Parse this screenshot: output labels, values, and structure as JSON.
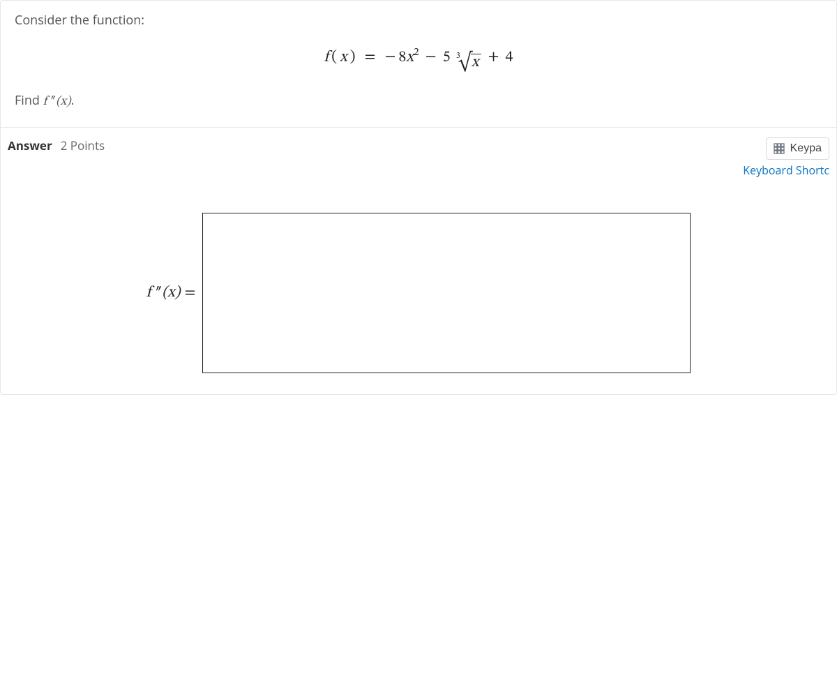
{
  "question": {
    "intro": "Consider the function:",
    "formula_plain": "f(x) = −8x² − 5 ∛x + 4",
    "find_prefix": "Find ",
    "find_expr": "f ″(x)",
    "find_suffix": "."
  },
  "answer": {
    "label": "Answer",
    "points": "2 Points",
    "keypad_label": "Keypa",
    "shortcut_label": "Keyboard Shortc",
    "lhs": "f ″(x) =",
    "box_value": ""
  }
}
